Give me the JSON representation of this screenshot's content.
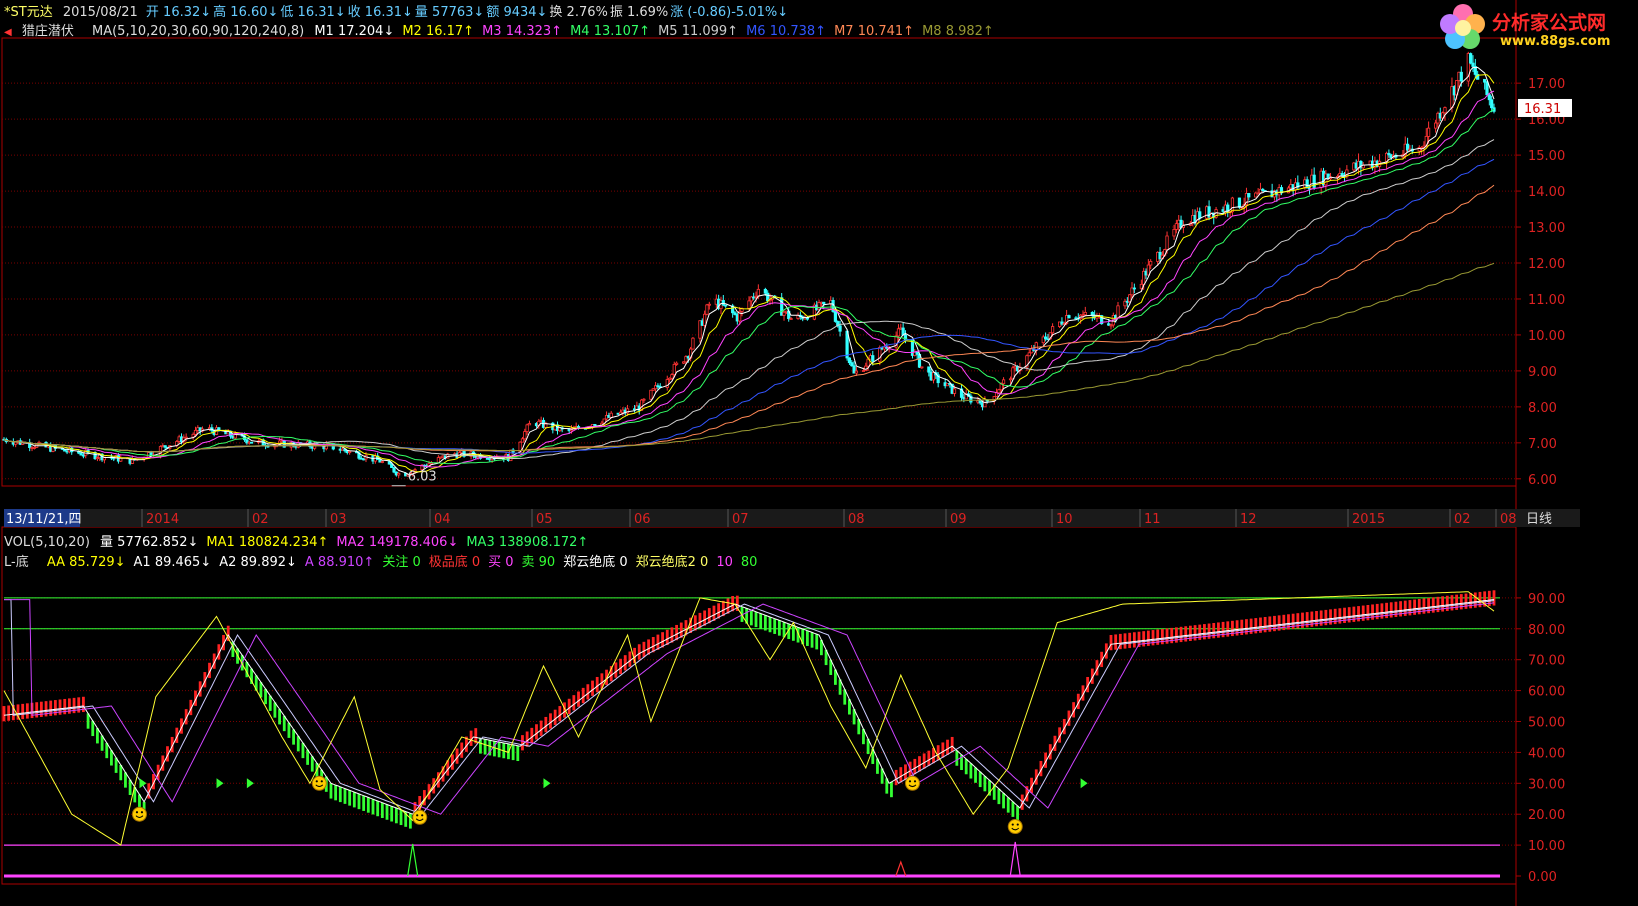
{
  "header": {
    "stock_name": "*ST元达",
    "date": "2015/08/21",
    "quote": [
      {
        "label": "开",
        "value": "16.32↓",
        "color": "#66ccff"
      },
      {
        "label": "高",
        "value": "16.60↓",
        "color": "#66ccff"
      },
      {
        "label": "低",
        "value": "16.31↓",
        "color": "#66ccff"
      },
      {
        "label": "收",
        "value": "16.31↓",
        "color": "#66ccff"
      },
      {
        "label": "量",
        "value": "57763↓",
        "color": "#66ccff"
      },
      {
        "label": "额",
        "value": "9434↓",
        "color": "#66ccff"
      },
      {
        "label": "换",
        "value": "2.76%",
        "color": "#dddddd"
      },
      {
        "label": "振",
        "value": "1.69%",
        "color": "#dddddd"
      },
      {
        "label": "涨",
        "value": "(-0.86)-5.01%↓",
        "color": "#66ccff"
      }
    ]
  },
  "ma_line": {
    "indicator": "猎庄潜伏",
    "params": "MA(5,10,20,30,60,90,120,240,8)",
    "items": [
      {
        "label": "M1",
        "value": "17.204↓",
        "color": "#ffffff"
      },
      {
        "label": "M2",
        "value": "16.17↑",
        "color": "#ffff00"
      },
      {
        "label": "M3",
        "value": "14.323↑",
        "color": "#ff44ff"
      },
      {
        "label": "M4",
        "value": "13.107↑",
        "color": "#33ff66"
      },
      {
        "label": "M5",
        "value": "11.099↑",
        "color": "#cccccc"
      },
      {
        "label": "M6",
        "value": "10.738↑",
        "color": "#3355ff"
      },
      {
        "label": "M7",
        "value": "10.741↑",
        "color": "#ff8855"
      },
      {
        "label": "M8",
        "value": "8.982↑",
        "color": "#999933"
      }
    ]
  },
  "vol_line": {
    "params": "VOL(5,10,20)",
    "items": [
      {
        "label": "量",
        "value": "57762.852↓",
        "color": "#ffffff"
      },
      {
        "label": "MA1",
        "value": "180824.234↑",
        "color": "#ffff00"
      },
      {
        "label": "MA2",
        "value": "149178.406↓",
        "color": "#ff44ff"
      },
      {
        "label": "MA3",
        "value": "138908.172↑",
        "color": "#33ff66"
      }
    ]
  },
  "ind_line": {
    "name": "L-底",
    "items": [
      {
        "label": "AA",
        "value": "85.729↓",
        "color": "#ffff00"
      },
      {
        "label": "A1",
        "value": "89.465↓",
        "color": "#ffffff"
      },
      {
        "label": "A2",
        "value": "89.892↓",
        "color": "#ffffff"
      },
      {
        "label": "A",
        "value": "88.910↑",
        "color": "#cc44ff"
      },
      {
        "label": "关注",
        "value": "0",
        "color": "#33ff33"
      },
      {
        "label": "极品底",
        "value": "0",
        "color": "#ff3333"
      },
      {
        "label": "买",
        "value": "0",
        "color": "#ff44ff"
      },
      {
        "label": "卖",
        "value": "90",
        "color": "#33ff33"
      },
      {
        "label": "郑云绝底",
        "value": "0",
        "color": "#ffffff"
      },
      {
        "label": "郑云绝底2",
        "value": "0",
        "color": "#ffff66"
      },
      {
        "label": "",
        "value": "10",
        "color": "#ff44ff"
      },
      {
        "label": "",
        "value": "80",
        "color": "#33ff33"
      }
    ]
  },
  "logo": {
    "title": "分析家公式网",
    "url": "www.88gs.com"
  },
  "date_axis": {
    "cursor_date": "13/11/21,四",
    "period": "日线",
    "labels": [
      "2014",
      "02",
      "03",
      "04",
      "05",
      "06",
      "07",
      "08",
      "09",
      "10",
      "11",
      "12",
      "2015",
      "02",
      "08"
    ]
  },
  "colors": {
    "up": "#ff3333",
    "down": "#33ffff",
    "grid": "#7a0000",
    "axis": "#aa0000"
  },
  "chart_data": [
    {
      "type": "candlestick",
      "title": "猎庄潜伏",
      "ylim": [
        5.8,
        18.2
      ],
      "y_ticks": [
        6.0,
        7.0,
        8.0,
        9.0,
        10.0,
        11.0,
        12.0,
        13.0,
        14.0,
        15.0,
        16.0,
        17.0
      ],
      "current_price": "16.31",
      "low_annotation": "6.03",
      "close_path": [
        [
          "2013-11-21",
          7.1
        ],
        [
          "2013-12-15",
          6.8
        ],
        [
          "2014-01-15",
          6.5
        ],
        [
          "2014-02-15",
          7.4
        ],
        [
          "2014-03-10",
          7.0
        ],
        [
          "2014-04-10",
          6.9
        ],
        [
          "2014-05-01",
          6.5
        ],
        [
          "2014-05-10",
          6.1
        ],
        [
          "2014-06-01",
          6.7
        ],
        [
          "2014-06-25",
          6.6
        ],
        [
          "2014-07-05",
          7.6
        ],
        [
          "2014-07-20",
          7.3
        ],
        [
          "2014-08-20",
          8.0
        ],
        [
          "2014-09-10",
          9.5
        ],
        [
          "2014-09-20",
          11.0
        ],
        [
          "2014-10-01",
          10.5
        ],
        [
          "2014-10-10",
          11.3
        ],
        [
          "2014-10-25",
          10.4
        ],
        [
          "2014-11-10",
          10.9
        ],
        [
          "2014-11-20",
          8.9
        ],
        [
          "2014-12-10",
          10.1
        ],
        [
          "2014-12-20",
          9.0
        ],
        [
          "2015-01-05",
          8.3
        ],
        [
          "2015-01-15",
          8.1
        ],
        [
          "2015-02-05",
          9.6
        ],
        [
          "2015-02-20",
          10.6
        ],
        [
          "2015-03-10",
          10.4
        ],
        [
          "2015-04-10",
          13.2
        ],
        [
          "2015-07-20",
          15.2
        ],
        [
          "2015-08-10",
          17.6
        ],
        [
          "2015-08-21",
          16.31
        ]
      ],
      "series": [
        {
          "name": "M1",
          "ends": 17.204
        },
        {
          "name": "M2",
          "ends": 16.17
        },
        {
          "name": "M3",
          "ends": 14.323
        },
        {
          "name": "M4",
          "ends": 13.107
        },
        {
          "name": "M5",
          "ends": 11.099
        },
        {
          "name": "M6",
          "ends": 10.738
        },
        {
          "name": "M7",
          "ends": 10.741
        },
        {
          "name": "M8",
          "ends": 8.982
        }
      ]
    },
    {
      "type": "line",
      "title": "L-底",
      "ylim": [
        0,
        100
      ],
      "y_ticks": [
        0,
        10,
        20,
        30,
        40,
        50,
        60,
        70,
        80,
        90
      ],
      "hlines": [
        10,
        80,
        90
      ],
      "AA": [
        [
          "2013-11-21",
          60
        ],
        [
          "2013-12-20",
          20
        ],
        [
          "2014-01-10",
          10
        ],
        [
          "2014-01-25",
          58
        ],
        [
          "2014-02-20",
          84
        ],
        [
          "2014-03-20",
          45
        ],
        [
          "2014-04-01",
          30
        ],
        [
          "2014-04-20",
          58
        ],
        [
          "2014-05-01",
          28
        ],
        [
          "2014-05-15",
          18
        ],
        [
          "2014-06-05",
          45
        ],
        [
          "2014-06-25",
          40
        ],
        [
          "2014-07-10",
          68
        ],
        [
          "2014-07-25",
          45
        ],
        [
          "2014-08-15",
          78
        ],
        [
          "2014-08-25",
          50
        ],
        [
          "2014-09-15",
          90
        ],
        [
          "2014-09-30",
          88
        ],
        [
          "2014-10-15",
          70
        ],
        [
          "2014-10-25",
          82
        ],
        [
          "2014-11-10",
          55
        ],
        [
          "2014-11-25",
          35
        ],
        [
          "2014-12-10",
          65
        ],
        [
          "2014-12-25",
          40
        ],
        [
          "2015-01-10",
          20
        ],
        [
          "2015-01-25",
          35
        ],
        [
          "2015-02-15",
          82
        ],
        [
          "2015-03-15",
          88
        ],
        [
          "2015-08-10",
          92
        ],
        [
          "2015-08-21",
          85.729
        ]
      ],
      "A1": [
        [
          "2013-11-21",
          52
        ],
        [
          "2013-12-25",
          55
        ],
        [
          "2014-01-20",
          24
        ],
        [
          "2014-02-25",
          78
        ],
        [
          "2014-04-10",
          30
        ],
        [
          "2014-05-15",
          20
        ],
        [
          "2014-06-10",
          45
        ],
        [
          "2014-06-30",
          42
        ],
        [
          "2014-08-20",
          72
        ],
        [
          "2014-09-30",
          88
        ],
        [
          "2014-11-05",
          78
        ],
        [
          "2014-12-05",
          30
        ],
        [
          "2015-01-01",
          42
        ],
        [
          "2015-01-30",
          22
        ],
        [
          "2015-03-10",
          75
        ],
        [
          "2015-08-21",
          89.465
        ]
      ],
      "markers": [
        {
          "type": "smile",
          "date": "2014-01-18",
          "value": 20
        },
        {
          "type": "smile",
          "date": "2014-04-05",
          "value": 30
        },
        {
          "type": "smile",
          "date": "2014-05-18",
          "value": 19
        },
        {
          "type": "smile",
          "date": "2014-12-15",
          "value": 30
        },
        {
          "type": "smile",
          "date": "2015-01-28",
          "value": 16
        }
      ]
    }
  ]
}
